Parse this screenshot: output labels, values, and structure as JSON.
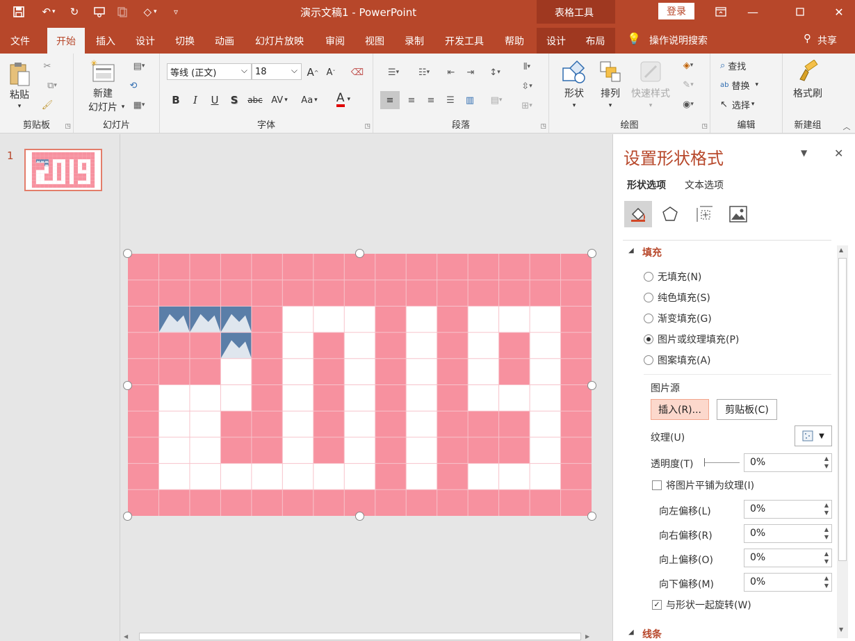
{
  "titlebar": {
    "title": "演示文稿1  -  PowerPoint",
    "context_tab": "表格工具",
    "login": "登录"
  },
  "tabs": [
    "文件",
    "开始",
    "插入",
    "设计",
    "切换",
    "动画",
    "幻灯片放映",
    "审阅",
    "视图",
    "录制",
    "开发工具",
    "帮助"
  ],
  "context_tabs": [
    "设计",
    "布局"
  ],
  "tell_me": "操作说明搜索",
  "share": "共享",
  "ribbon": {
    "clipboard": {
      "label": "剪贴板",
      "paste": "粘贴"
    },
    "slides": {
      "label": "幻灯片",
      "new_slide_1": "新建",
      "new_slide_2": "幻灯片"
    },
    "font": {
      "label": "字体",
      "name": "等线 (正文)",
      "size": "18",
      "grow": "A",
      "shrink": "A",
      "b": "B",
      "i": "I",
      "u": "U",
      "s": "S",
      "abc": "abc",
      "av": "AV",
      "aa": "Aa",
      "color": "A"
    },
    "paragraph": {
      "label": "段落"
    },
    "drawing": {
      "label": "绘图",
      "shape": "形状",
      "arrange": "排列",
      "quick": "快速样式"
    },
    "editing": {
      "label": "编辑",
      "find": "查找",
      "replace": "替换",
      "select": "选择"
    },
    "newgroup": {
      "label": "新建组",
      "painter": "格式刷"
    }
  },
  "thumbnail": {
    "number": "1"
  },
  "slide": {
    "text": "2019",
    "grid_cols": 15,
    "grid_rows": 10,
    "pink": "#f7919f",
    "photo_cells": [
      [
        1,
        2
      ],
      [
        2,
        2
      ],
      [
        3,
        2
      ],
      [
        3,
        3
      ]
    ]
  },
  "pane": {
    "title": "设置形状格式",
    "tab_shape": "形状选项",
    "tab_text": "文本选项",
    "section_fill": "填充",
    "fill_options": [
      "无填充(N)",
      "纯色填充(S)",
      "渐变填充(G)",
      "图片或纹理填充(P)",
      "图案填充(A)"
    ],
    "selected_fill": 3,
    "pic_source": "图片源",
    "insert": "插入(R)...",
    "clipboard": "剪贴板(C)",
    "texture": "纹理(U)",
    "transparency": "透明度(T)",
    "transparency_value": "0%",
    "tile": "将图片平铺为纹理(I)",
    "offsets": [
      {
        "label": "向左偏移(L)",
        "value": "0%"
      },
      {
        "label": "向右偏移(R)",
        "value": "0%"
      },
      {
        "label": "向上偏移(O)",
        "value": "0%"
      },
      {
        "label": "向下偏移(M)",
        "value": "0%"
      }
    ],
    "rotate": "与形状一起旋转(W)",
    "section_line": "线条"
  },
  "colors": {
    "accent": "#b7472a",
    "accent_dark": "#9f3820",
    "pink": "#f7919f"
  }
}
